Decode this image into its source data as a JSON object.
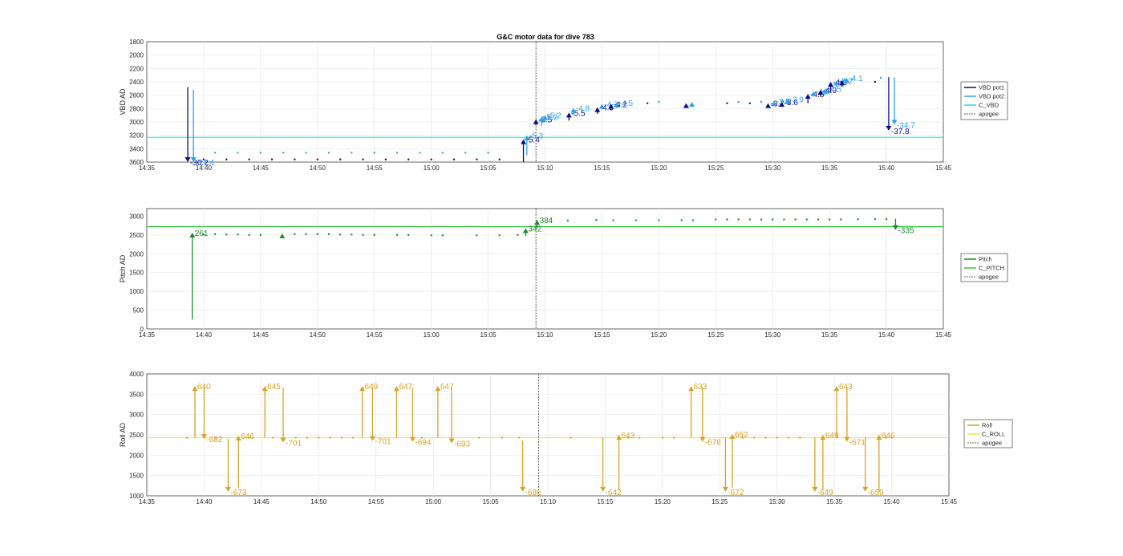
{
  "title": "G&C motor data for dive 783",
  "x_ticks": [
    "14:35",
    "14:40",
    "14:45",
    "14:50",
    "14:55",
    "15:00",
    "15:05",
    "15:10",
    "15:15",
    "15:20",
    "15:25",
    "15:30",
    "15:35",
    "15:40",
    "15:45"
  ],
  "colors": {
    "vbd_pot1": "#0a0a8c",
    "vbd_pot2": "#2aa3e8",
    "c_vbd": "#22dede",
    "pitch": "#1f8a2a",
    "c_pitch": "#28c83a",
    "roll": "#d9a227",
    "c_roll": "#f2e34a",
    "apogee": "#333333"
  },
  "chart_data": [
    {
      "type": "scatter",
      "title": "G&C motor data for dive 783",
      "ylabel": "VBD AD",
      "xlim": [
        "14:35",
        "15:45"
      ],
      "ylim": [
        1800,
        3600
      ],
      "y_reversed": true,
      "yticks": [
        "1800",
        "2000",
        "2200",
        "2400",
        "2600",
        "2800",
        "3000",
        "3200",
        "3400",
        "3600"
      ],
      "grid": true,
      "legend_position": "right",
      "legend": [
        "VBD pot1",
        "VBD pot2",
        "C_VBD",
        "apogee"
      ],
      "c_value": 3230,
      "apogee": "15:09.2",
      "series": [
        {
          "name": "VBD pot1",
          "x": [
            "14:40",
            "14:42",
            "14:44",
            "14:46",
            "14:48",
            "14:50",
            "14:52",
            "14:54",
            "14:56",
            "14:58",
            "15:00",
            "15:02",
            "15:04",
            "15:06",
            "15:16.5",
            "15:19",
            "15:26",
            "15:28",
            "15:36",
            "15:39"
          ],
          "y": [
            3560,
            3560,
            3560,
            3560,
            3560,
            3560,
            3560,
            3560,
            3560,
            3560,
            3560,
            3560,
            3560,
            3560,
            2760,
            2720,
            2720,
            2720,
            2400,
            2400
          ]
        },
        {
          "name": "VBD pot2",
          "x": [
            "14:41",
            "14:43",
            "14:45",
            "14:47",
            "14:49",
            "14:51",
            "14:53",
            "14:55",
            "14:57",
            "14:59",
            "15:01",
            "15:03",
            "15:05",
            "15:17",
            "15:20",
            "15:27",
            "15:29",
            "15:37",
            "15:39.5"
          ],
          "y": [
            3460,
            3460,
            3460,
            3460,
            3460,
            3460,
            3460,
            3460,
            3460,
            3460,
            3460,
            3460,
            3460,
            2730,
            2700,
            2700,
            2700,
            2360,
            2340
          ]
        }
      ],
      "moves": [
        {
          "series": "VBD pot1",
          "x": "14:38.6",
          "from": 2480,
          "to": 3600,
          "label": "-30.2"
        },
        {
          "series": "VBD pot2",
          "x": "14:39.1",
          "from": 2520,
          "to": 3600,
          "label": "-27.4"
        },
        {
          "series": "VBD pot1",
          "x": "15:08.1",
          "from": 3600,
          "to": 3260,
          "label": "-5.4"
        },
        {
          "series": "VBD pot2",
          "x": "15:08.4",
          "from": 3500,
          "to": 3200,
          "label": "-5.3"
        },
        {
          "series": "VBD pot1",
          "x": "15:09.2",
          "from": 3050,
          "to": 2960,
          "label": "-5.5"
        },
        {
          "series": "VBD pot2",
          "x": "15:09.7",
          "from": 3060,
          "to": 2920,
          "label": "-5.2"
        },
        {
          "series": "VBD pot2",
          "x": "15:10.0",
          "from": 3000,
          "to": 2900,
          "label": "-5.2"
        },
        {
          "series": "VBD pot1",
          "x": "15:12.1",
          "from": 2980,
          "to": 2860,
          "label": "-5.5"
        },
        {
          "series": "VBD pot2",
          "x": "15:12.5",
          "from": 2900,
          "to": 2790,
          "label": "-4.8"
        },
        {
          "series": "VBD pot1",
          "x": "15:14.6",
          "from": 2880,
          "to": 2780,
          "label": "-4.5"
        },
        {
          "series": "VBD pot2",
          "x": "15:15.0",
          "from": 2810,
          "to": 2730,
          "label": "-4.2"
        },
        {
          "series": "VBD pot1",
          "x": "15:15.8",
          "from": 2820,
          "to": 2730,
          "label": "-4.2"
        },
        {
          "series": "VBD pot2",
          "x": "15:16.3",
          "from": 2790,
          "to": 2710,
          "label": "-4.5"
        },
        {
          "series": "VBD pot1",
          "x": "15:22.4",
          "from": 2780,
          "to": 2720,
          "label": ""
        },
        {
          "series": "VBD pot2",
          "x": "15:22.9",
          "from": 2760,
          "to": 2700,
          "label": ""
        },
        {
          "series": "VBD pot1",
          "x": "15:29.6",
          "from": 2760,
          "to": 2720,
          "label": "-3.7"
        },
        {
          "series": "VBD pot2",
          "x": "15:30.1",
          "from": 2730,
          "to": 2690,
          "label": "-3.5"
        },
        {
          "series": "VBD pot1",
          "x": "15:30.8",
          "from": 2760,
          "to": 2700,
          "label": "-3.6"
        },
        {
          "series": "VBD pot2",
          "x": "15:31.3",
          "from": 2720,
          "to": 2660,
          "label": "-3.9"
        },
        {
          "series": "VBD pot1",
          "x": "15:33.1",
          "from": 2720,
          "to": 2580,
          "label": "-4.6"
        },
        {
          "series": "VBD pot2",
          "x": "15:33.6",
          "from": 2620,
          "to": 2540,
          "label": "-4.5"
        },
        {
          "series": "VBD pot1",
          "x": "15:34.2",
          "from": 2620,
          "to": 2520,
          "label": "-4.9"
        },
        {
          "series": "VBD pot2",
          "x": "15:34.6",
          "from": 2600,
          "to": 2500,
          "label": "-4.5"
        },
        {
          "series": "VBD pot1",
          "x": "15:35.1",
          "from": 2560,
          "to": 2400,
          "label": "-4.0"
        },
        {
          "series": "VBD pot2",
          "x": "15:35.6",
          "from": 2480,
          "to": 2380,
          "label": "-5.2"
        },
        {
          "series": "VBD pot1",
          "x": "15:36.1",
          "from": 2480,
          "to": 2380,
          "label": ""
        },
        {
          "series": "VBD pot2",
          "x": "15:36.5",
          "from": 2420,
          "to": 2340,
          "label": "-4.1"
        },
        {
          "series": "VBD pot1",
          "x": "15:40.2",
          "from": 2330,
          "to": 3130,
          "label": "-37.8"
        },
        {
          "series": "VBD pot2",
          "x": "15:40.7",
          "from": 2340,
          "to": 3040,
          "label": "-34.7"
        }
      ]
    },
    {
      "type": "scatter",
      "ylabel": "Pitch AD",
      "xlim": [
        "14:35",
        "15:45"
      ],
      "ylim": [
        0,
        3200
      ],
      "yticks": [
        "0",
        "500",
        "1000",
        "1500",
        "2000",
        "2500",
        "3000"
      ],
      "grid": true,
      "legend_position": "right",
      "legend": [
        "Pitch",
        "C_PITCH",
        "apogee"
      ],
      "c_value": 2720,
      "apogee": "15:09.2",
      "series": [
        {
          "name": "Pitch",
          "x": [
            "14:40",
            "14:41",
            "14:42",
            "14:43",
            "14:44",
            "14:45",
            "14:48",
            "14:49",
            "14:50",
            "14:51",
            "14:52",
            "14:53",
            "14:54",
            "14:55",
            "14:57",
            "14:58",
            "15:00",
            "15:01",
            "15:04",
            "15:06",
            "15:07.6",
            "15:12",
            "15:14.5",
            "15:16",
            "15:18",
            "15:20",
            "15:22",
            "15:23",
            "15:25",
            "15:26",
            "15:27",
            "15:28",
            "15:29",
            "15:30",
            "15:31",
            "15:32",
            "15:33",
            "15:34",
            "15:35",
            "15:36",
            "15:37.5",
            "15:39",
            "15:40"
          ],
          "y": [
            2510,
            2520,
            2510,
            2510,
            2500,
            2500,
            2520,
            2520,
            2520,
            2520,
            2510,
            2510,
            2500,
            2500,
            2500,
            2500,
            2490,
            2490,
            2490,
            2490,
            2500,
            2880,
            2900,
            2890,
            2890,
            2890,
            2890,
            2890,
            2910,
            2910,
            2910,
            2910,
            2910,
            2910,
            2910,
            2910,
            2910,
            2910,
            2910,
            2910,
            2920,
            2920,
            2920
          ]
        }
      ],
      "moves": [
        {
          "series": "Pitch",
          "x": "14:39.0",
          "from": 250,
          "to": 2560,
          "label": "261"
        },
        {
          "series": "Pitch",
          "x": "14:46.9",
          "from": 2480,
          "to": 2540,
          "label": ""
        },
        {
          "series": "Pitch",
          "x": "15:08.3",
          "from": 2470,
          "to": 2680,
          "label": "342"
        },
        {
          "series": "Pitch",
          "x": "15:09.3",
          "from": 2670,
          "to": 2900,
          "label": "384"
        },
        {
          "series": "Pitch",
          "x": "15:40.8",
          "from": 2930,
          "to": 2630,
          "label": "-335"
        }
      ]
    },
    {
      "type": "scatter",
      "ylabel": "Roll AD",
      "xlim": [
        "14:35",
        "15:45"
      ],
      "ylim": [
        1000,
        4000
      ],
      "yticks": [
        "1000",
        "1500",
        "2000",
        "2500",
        "3000",
        "3500",
        "4000"
      ],
      "grid": true,
      "legend_position": "right",
      "legend": [
        "Roll",
        "C_ROLL",
        "apogee"
      ],
      "c_value": 2430,
      "apogee": "15:09.2",
      "series": [
        {
          "name": "Roll",
          "x": [
            "14:38.5",
            "14:41",
            "14:44",
            "14:46",
            "14:48",
            "14:49",
            "14:50",
            "14:51",
            "14:52",
            "14:53",
            "14:59",
            "15:04",
            "15:06",
            "15:07.5",
            "15:12",
            "15:17",
            "15:18",
            "15:20",
            "15:21",
            "15:27",
            "15:28",
            "15:29",
            "15:30",
            "15:31",
            "15:32",
            "15:39.5",
            "15:40"
          ],
          "y": [
            2430,
            2430,
            2430,
            2430,
            2430,
            2430,
            2430,
            2430,
            2430,
            2430,
            2430,
            2430,
            2430,
            2430,
            2430,
            2430,
            2430,
            2430,
            2430,
            2430,
            2430,
            2430,
            2430,
            2430,
            2430,
            2430,
            2430
          ]
        }
      ],
      "moves": [
        {
          "series": "Roll",
          "x": "14:39.2",
          "from": 2430,
          "to": 3700,
          "label": "640"
        },
        {
          "series": "Roll",
          "x": "14:40.0",
          "from": 3660,
          "to": 2400,
          "label": "-682"
        },
        {
          "series": "Roll",
          "x": "14:42.1",
          "from": 2400,
          "to": 1100,
          "label": "-673"
        },
        {
          "series": "Roll",
          "x": "14:43.0",
          "from": 1200,
          "to": 2480,
          "label": "646"
        },
        {
          "series": "Roll",
          "x": "14:45.3",
          "from": 2430,
          "to": 3700,
          "label": "645"
        },
        {
          "series": "Roll",
          "x": "14:46.9",
          "from": 3660,
          "to": 2310,
          "label": "-701"
        },
        {
          "series": "Roll",
          "x": "14:53.8",
          "from": 2430,
          "to": 3700,
          "label": "649"
        },
        {
          "series": "Roll",
          "x": "14:54.7",
          "from": 3660,
          "to": 2350,
          "label": "-701"
        },
        {
          "series": "Roll",
          "x": "14:56.8",
          "from": 2430,
          "to": 3700,
          "label": "647"
        },
        {
          "series": "Roll",
          "x": "14:58.2",
          "from": 3660,
          "to": 2330,
          "label": "-694"
        },
        {
          "series": "Roll",
          "x": "15:00.4",
          "from": 2430,
          "to": 3700,
          "label": "647"
        },
        {
          "series": "Roll",
          "x": "15:01.6",
          "from": 3660,
          "to": 2290,
          "label": "-693"
        },
        {
          "series": "Roll",
          "x": "15:07.8",
          "from": 2360,
          "to": 1100,
          "label": "-686"
        },
        {
          "series": "Roll",
          "x": "15:14.8",
          "from": 2430,
          "to": 1100,
          "label": "-642"
        },
        {
          "series": "Roll",
          "x": "15:16.2",
          "from": 1150,
          "to": 2500,
          "label": "643"
        },
        {
          "series": "Roll",
          "x": "15:22.5",
          "from": 2430,
          "to": 3700,
          "label": "633"
        },
        {
          "series": "Roll",
          "x": "15:23.5",
          "from": 3660,
          "to": 2330,
          "label": "-678"
        },
        {
          "series": "Roll",
          "x": "15:25.5",
          "from": 2430,
          "to": 1100,
          "label": "-672"
        },
        {
          "series": "Roll",
          "x": "15:26.1",
          "from": 1200,
          "to": 2520,
          "label": "652"
        },
        {
          "series": "Roll",
          "x": "15:33.3",
          "from": 2430,
          "to": 1100,
          "label": "-649"
        },
        {
          "series": "Roll",
          "x": "15:34.0",
          "from": 1150,
          "to": 2500,
          "label": "649"
        },
        {
          "series": "Roll",
          "x": "15:35.2",
          "from": 2430,
          "to": 3700,
          "label": "643"
        },
        {
          "series": "Roll",
          "x": "15:36.1",
          "from": 3660,
          "to": 2330,
          "label": "-671"
        },
        {
          "series": "Roll",
          "x": "15:37.7",
          "from": 2430,
          "to": 1100,
          "label": "-659"
        },
        {
          "series": "Roll",
          "x": "15:38.9",
          "from": 1100,
          "to": 2500,
          "label": "646"
        }
      ]
    }
  ]
}
